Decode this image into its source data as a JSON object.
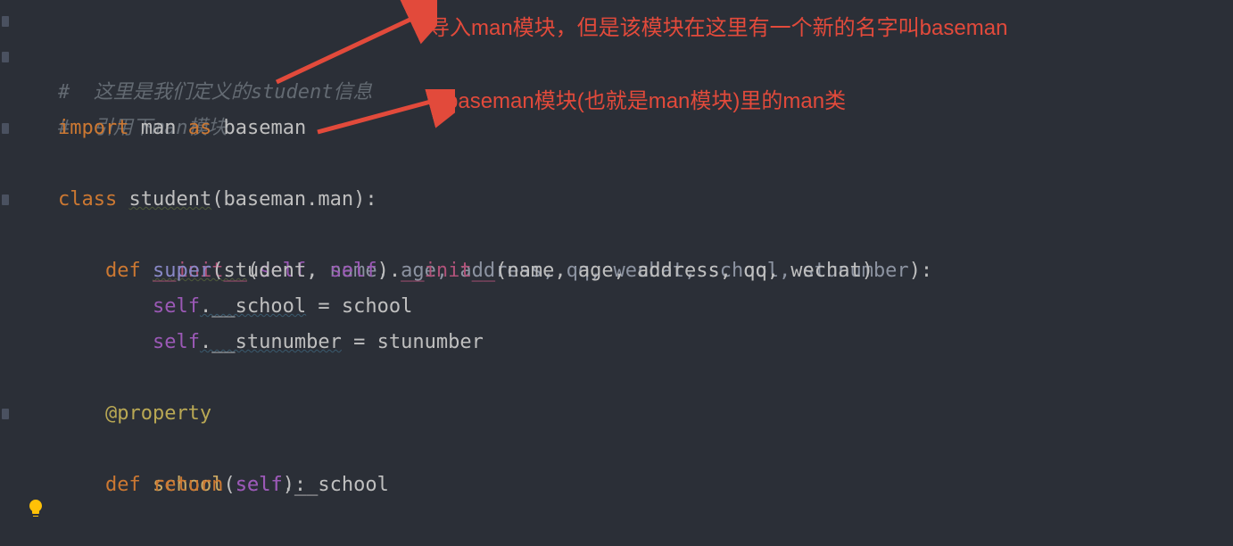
{
  "code": {
    "line1_comment": "#  这里是我们定义的student信息",
    "line2_comment": "#  引用下man模块",
    "line3": {
      "kw_import": "import",
      "name1": "man",
      "kw_as": "as",
      "name2": "baseman"
    },
    "line4": {
      "kw_class": "class",
      "classname": "student",
      "base": "baseman.man"
    },
    "line6": {
      "kw_def": "def",
      "fname": "__init__",
      "self": "self",
      "params": ", name, age, address, qq, wechat, school, stunumber"
    },
    "line7": {
      "super": "super",
      "arg_class": "student",
      "self": "self",
      "dunder": "__init__",
      "args": "(name, age, address, qq, wechat)"
    },
    "line8": {
      "self": "self",
      "attr": ".__school",
      "eq": " = ",
      "rhs": "school"
    },
    "line9": {
      "self": "self",
      "attr": ".__stunumber",
      "eq": " = ",
      "rhs": "stunumber"
    },
    "line11_deco": "@property",
    "line12": {
      "kw_def": "def",
      "fname": "school",
      "self": "self"
    },
    "line13": {
      "kw_return": "return",
      "self": "self",
      "attr": ".__school"
    }
  },
  "annotations": {
    "a1": "导入man模块，但是该模块在这里有一个新的名字叫baseman",
    "a2": "baseman模块(也就是man模块)里的man类"
  },
  "icons": {
    "bulb": "lightbulb-icon"
  }
}
